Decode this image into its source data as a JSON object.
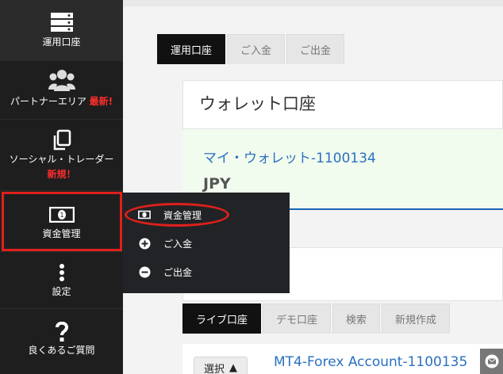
{
  "sidebar": {
    "items": [
      {
        "label": "運用口座",
        "icon": "server-icon"
      },
      {
        "label": "パートナーエリア",
        "badge": "最新!",
        "icon": "users-icon"
      },
      {
        "label": "ソーシャル・トレーダー",
        "badge": "新規！",
        "icon": "copy-icon"
      },
      {
        "label": "資金管理",
        "icon": "money-icon"
      },
      {
        "label": "設定",
        "icon": "vertical-dots-icon"
      },
      {
        "label": "良くあるご質問",
        "icon": "question-icon"
      }
    ]
  },
  "flyout": {
    "items": [
      {
        "label": "資金管理",
        "icon": "money-icon"
      },
      {
        "label": "ご入金",
        "icon": "plus-circle-icon"
      },
      {
        "label": "ご出金",
        "icon": "minus-circle-icon"
      }
    ]
  },
  "top_tabs": [
    "運用口座",
    "ご入金",
    "ご出金"
  ],
  "wallet_card": {
    "title": "ウォレット口座",
    "wallet_name": "マイ・ウォレット-1100134",
    "currency": "JPY"
  },
  "account_tabs": [
    "ライブ口座",
    "デモ口座",
    "検索",
    "新規作成"
  ],
  "account_row": {
    "select_label": "選択",
    "account_name": "MT4-Forex Account-1100135"
  },
  "colors": {
    "highlight": "#e0201c",
    "link": "#2a71c0",
    "sidebar": "#1e1e1e"
  }
}
